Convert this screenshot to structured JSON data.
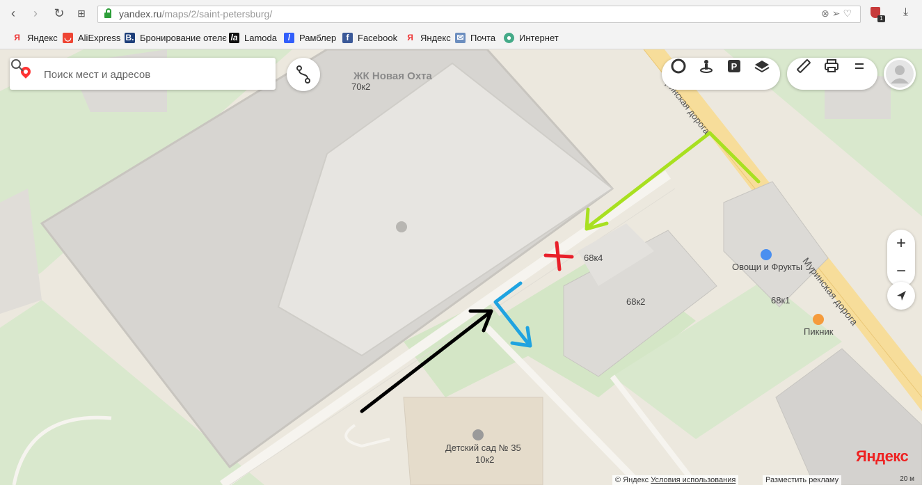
{
  "browser": {
    "url": "yandex.ru/maps/2/saint-petersburg/",
    "url_domain": "yandex.ru",
    "url_path": "/maps/2/saint-petersburg/",
    "extension_badge": "1",
    "bookmarks": [
      {
        "label": "Яндекс",
        "icon": "yandex-icon",
        "color": "#e33"
      },
      {
        "label": "AliExpress",
        "icon": "aliexpress-icon",
        "color": "#e43"
      },
      {
        "label": "Бронирование отелє",
        "icon": "booking-icon",
        "color": "#1e3f7a"
      },
      {
        "label": "Lamoda",
        "icon": "lamoda-icon",
        "color": "#111"
      },
      {
        "label": "Рамблер",
        "icon": "rambler-icon",
        "color": "#315efb"
      },
      {
        "label": "Facebook",
        "icon": "facebook-icon",
        "color": "#3b5998"
      },
      {
        "label": "Яндекс",
        "icon": "yandex-icon",
        "color": "#e33"
      },
      {
        "label": "Почта",
        "icon": "mail-icon",
        "color": "#6c8ebf"
      },
      {
        "label": "Интернет",
        "icon": "internet-icon",
        "color": "#4a8"
      }
    ]
  },
  "map": {
    "search_placeholder": "Поиск мест и адресов",
    "labels": {
      "complex": "ЖК Новая Охта",
      "b70k2": "70к2",
      "b68k4": "68к4",
      "b68k2": "68к2",
      "b68k1": "68к1",
      "b10k2": "10к2",
      "shop": "Овощи и Фрукты",
      "cafe": "Пикник",
      "kindergarten": "Детский сад № 35",
      "road_top": "ринская дорога",
      "road": "Муринская дорога"
    },
    "footer": {
      "copyright": "© Яндекс",
      "terms": "Условия использования",
      "ad": "Разместить рекламу",
      "scale": "20 м"
    },
    "logo": "Яндекс",
    "colors": {
      "background": "#ece8de",
      "building": "#d9d6d0",
      "lawn": "#cfe3c1",
      "road_main": "#f7dd9a",
      "arrow_green": "#a8e020",
      "arrow_black": "#000000",
      "arrow_blue": "#1fa3e0",
      "cross_red": "#e8202a"
    }
  }
}
